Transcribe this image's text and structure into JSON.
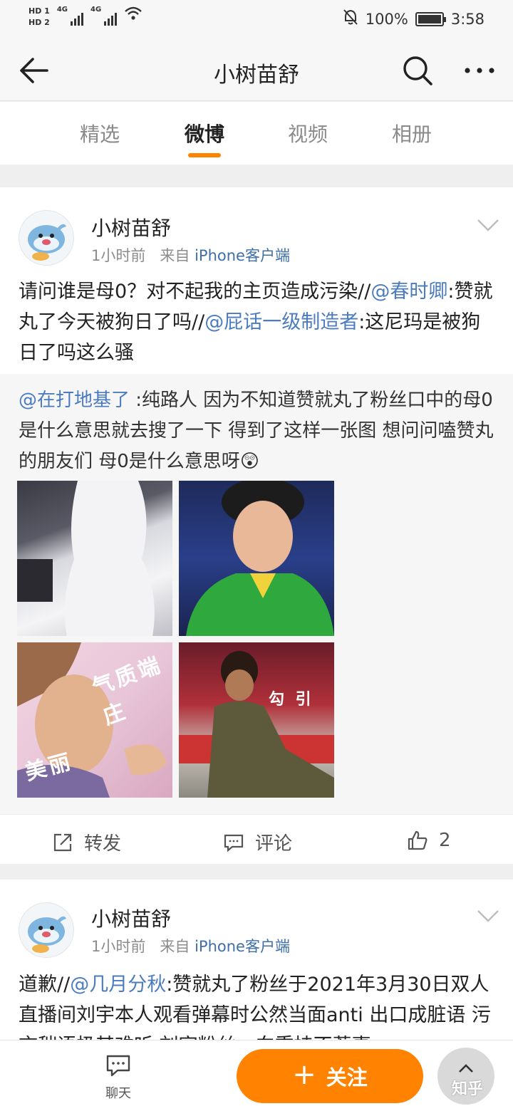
{
  "status_bar": {
    "hd1": "HD 1",
    "hd2": "HD 2",
    "net1": "4G",
    "net2": "4G",
    "battery": "100%",
    "time": "3:58",
    "icons": [
      "mute-bell-icon",
      "battery-charging-icon",
      "wifi-icon",
      "signal-icon"
    ]
  },
  "header": {
    "title": "小树苗舒",
    "icons": [
      "back-arrow-icon",
      "search-icon",
      "more-dots-icon"
    ]
  },
  "tabs": [
    {
      "label": "精选",
      "active": false
    },
    {
      "label": "微博",
      "active": true
    },
    {
      "label": "视频",
      "active": false
    },
    {
      "label": "相册",
      "active": false
    }
  ],
  "accent_color": "#ff8200",
  "link_color": "#4b7cc0",
  "posts": [
    {
      "author": "小树苗舒",
      "time": "1小时前",
      "source_prefix": "来自",
      "source": "iPhone客户端",
      "text": {
        "t1": "请问谁是母0？对不起我的主页造成污染//",
        "m1": "@春时卿",
        "t2": ":赞就丸了今天被狗日了吗//",
        "m2": "@屁话一级制造者",
        "t3": ":这尼玛是被狗日了吗这么骚"
      },
      "repost": {
        "mention": "@在打地基了",
        "text": " :纯路人 因为不知道赞就丸了粉丝口中的母0是什么意思就去搜了一下 得到了这样一张图 想问问嗑赞丸的朋友们 母0是什么意思呀",
        "emoji": "😲",
        "image_captions": [
          "气质端庄",
          "美丽",
          "勾 引"
        ]
      },
      "actions": {
        "repost": "转发",
        "comment": "评论",
        "like_count": "2"
      }
    },
    {
      "author": "小树苗舒",
      "time": "1小时前",
      "source_prefix": "来自",
      "source": "iPhone客户端",
      "text": {
        "t1": "道歉//",
        "m1": "@几月分秋",
        "t2": ":赞就丸了粉丝于2021年3月30日双人直播间刘宇本人观看弹幕时公然当面anti 出口成脏语 污言秽语极其难听 刘宇粉丝一向秉持不惹事"
      }
    }
  ],
  "bottom_bar": {
    "chat": "聊天",
    "follow": "关注",
    "plus": "+",
    "watermark": "知乎"
  }
}
